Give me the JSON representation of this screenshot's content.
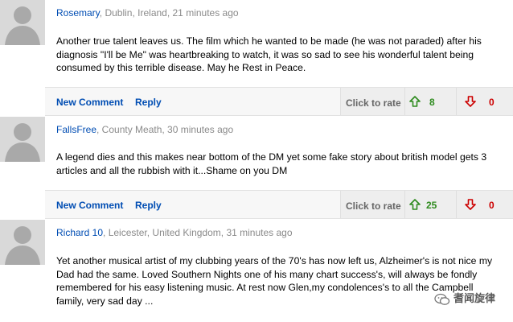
{
  "comments": [
    {
      "user": "Rosemary",
      "location_time": ", Dublin, Ireland, 21 minutes ago",
      "text": "Another true talent leaves us. The film which he wanted to be made (he was not paraded) after his diagnosis \"I'll be Me\" was heartbreaking to watch, it was so sad to see his wonderful talent being consumed by this terrible disease. May he Rest in Peace.",
      "new_comment_label": "New Comment",
      "reply_label": "Reply",
      "click_to_rate": "Click to rate",
      "up_count": "8",
      "down_count": "0",
      "up_icon": "arrow-up-icon",
      "down_icon": "arrow-down-icon"
    },
    {
      "user": "FallsFree",
      "location_time": ", County Meath, 30 minutes ago",
      "text": "A legend dies and this makes near bottom of the DM yet some fake story about british model gets 3 articles and all the rubbish with it...Shame on you DM",
      "new_comment_label": "New Comment",
      "reply_label": "Reply",
      "click_to_rate": "Click to rate",
      "up_count": "25",
      "down_count": "0",
      "up_icon": "arrow-up-icon",
      "down_icon": "arrow-down-icon"
    },
    {
      "user": "Richard 10",
      "location_time": ", Leicester, United Kingdom, 31 minutes ago",
      "text": "Yet another musical artist of my clubbing years of the 70's has now left us, Alzheimer's is not nice my Dad had the same. Loved Southern Nights one of his many chart success's, will always be fondly remembered for his easy listening music. At rest now Glen,my condolences's to all the Campbell family, very sad day ..."
    }
  ],
  "watermark": {
    "text": "耆闻旋律",
    "icon": "wechat-icon"
  },
  "colors": {
    "link": "#004db3",
    "up": "#2e8b1e",
    "down": "#cc0000",
    "meta": "#8a8a8a"
  }
}
